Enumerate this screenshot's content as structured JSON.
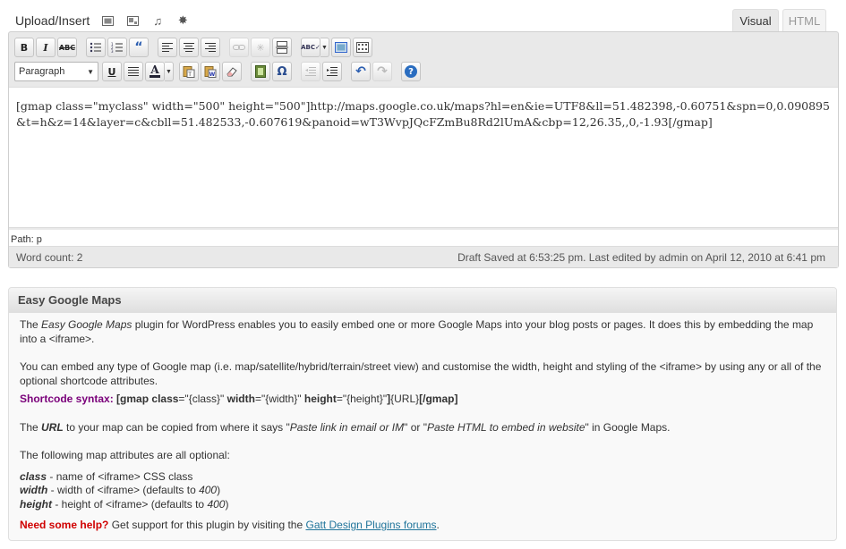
{
  "upload": {
    "label": "Upload/Insert",
    "icons": [
      "image-icon",
      "video-icon",
      "audio-icon",
      "media-icon"
    ]
  },
  "tabs": {
    "visual": "Visual",
    "html": "HTML"
  },
  "toolbar": {
    "format_select": "Paragraph",
    "bold": "B",
    "italic": "I",
    "strike": "ABC",
    "underline": "U",
    "text_color": "A",
    "omega": "Ω",
    "help": "?"
  },
  "editor": {
    "content": "[gmap class=\"myclass\" width=\"500\" height=\"500\"]http://maps.google.co.uk/maps?hl=en&ie=UTF8&ll=51.482398,-0.60751&spn=0,0.090895&t=h&z=14&layer=c&cbll=51.482533,-0.607619&panoid=wT3WvpJQcFZmBu8Rd2lUmA&cbp=12,26.35,,0,-1.93[/gmap]",
    "path": "Path: p",
    "word_count": "Word count: 2",
    "draft_status": "Draft Saved at 6:53:25 pm. Last edited by admin on April 12, 2010 at 6:41 pm"
  },
  "metabox": {
    "title": "Easy Google Maps",
    "p1_prefix": "The ",
    "p1_plugin": "Easy Google Maps",
    "p1_rest": " plugin for WordPress enables you to easily embed one or more Google Maps into your blog posts or pages. It does this by embedding the map into a <iframe>.",
    "p2": "You can embed any type of Google map (i.e. map/satellite/hybrid/terrain/street view) and customise the width, height and styling of the <iframe> by using any or all of the optional shortcode attributes.",
    "shortcode_label": "Shortcode syntax:",
    "sc_open": "[gmap ",
    "sc_class": "class",
    "sc_class_val": "=\"{class}\" ",
    "sc_width": "width",
    "sc_width_val": "=\"{width}\" ",
    "sc_height": "height",
    "sc_height_val": "=\"{height}\"",
    "sc_mid": "]",
    "sc_url": "{URL}",
    "sc_close": "[/gmap]",
    "p4_prefix": "The ",
    "p4_url": "URL",
    "p4_mid1": " to your map can be copied from where it says \"",
    "p4_paste1": "Paste link in email or IM",
    "p4_mid2": "\" or \"",
    "p4_paste2": "Paste HTML to embed in website",
    "p4_end": "\" in Google Maps.",
    "p5": "The following map attributes are all optional:",
    "attr_class": "class",
    "attr_class_desc": " - name of <iframe> CSS class",
    "attr_width": "width",
    "attr_width_desc": " - width of <iframe> (defaults to ",
    "attr_width_default": "400",
    "attr_height": "height",
    "attr_height_desc": " - height of <iframe> (defaults to ",
    "attr_height_default": "400",
    "close_paren": ")",
    "help_label": "Need some help?",
    "help_text": " Get support for this plugin by visiting the ",
    "help_link": "Gatt Design Plugins forums",
    "help_end": "."
  },
  "colors": {
    "accent_purple": "#7a007a",
    "help_red": "#d00000",
    "link_blue": "#21759b"
  }
}
